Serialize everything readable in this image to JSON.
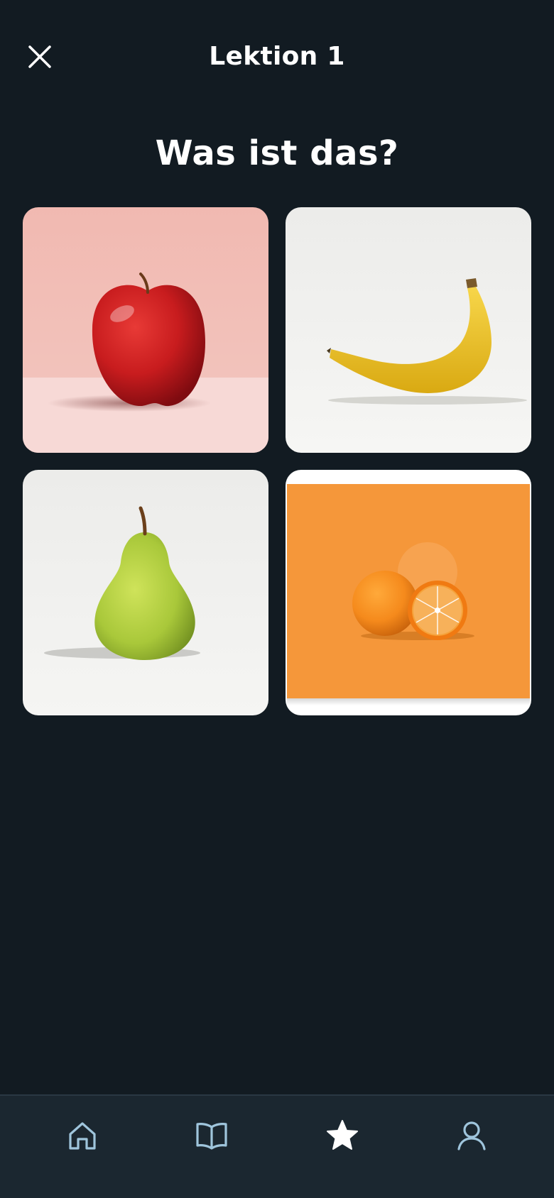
{
  "header": {
    "title": "Lektion 1",
    "close_icon": "close-icon"
  },
  "question": "Was ist das?",
  "options": [
    {
      "label": "",
      "image": "apple-image"
    },
    {
      "label": "",
      "image": "banana-image"
    },
    {
      "label": "",
      "image": "pear-image"
    },
    {
      "label": "",
      "image": "orange-image"
    }
  ],
  "bottom_nav": {
    "items": [
      {
        "icon": "home-icon",
        "label": "",
        "active": false
      },
      {
        "icon": "book-icon",
        "label": "",
        "active": false
      },
      {
        "icon": "star-icon",
        "label": "",
        "active": true
      },
      {
        "icon": "profile-icon",
        "label": "",
        "active": false
      }
    ]
  },
  "colors": {
    "background": "#121b22",
    "nav_background": "#1b2730",
    "nav_icon_inactive": "#9fc5dc",
    "nav_icon_active": "#ffffff",
    "text": "#ffffff"
  }
}
